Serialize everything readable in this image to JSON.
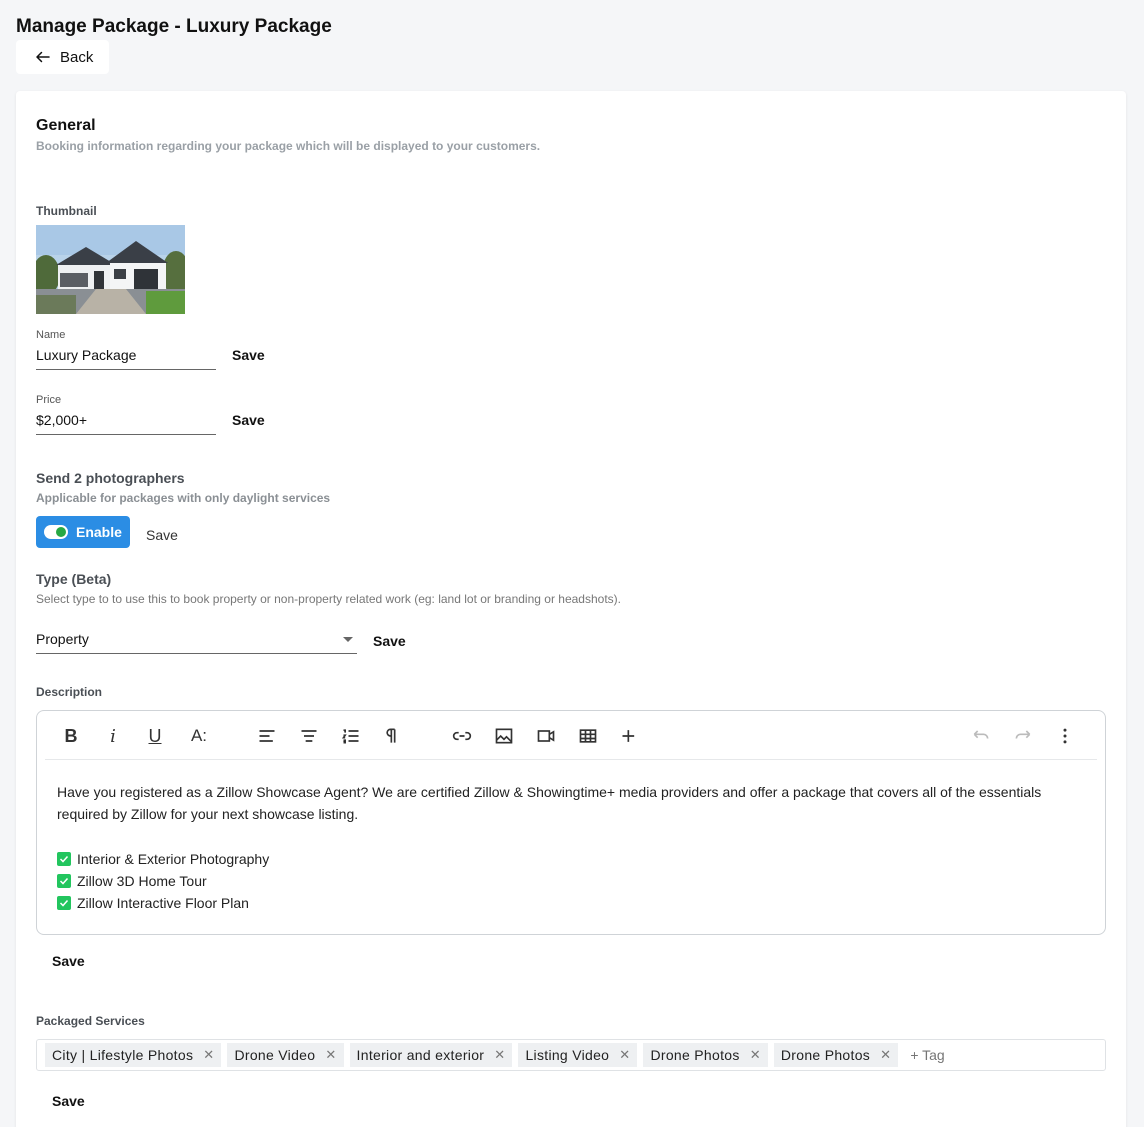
{
  "header": {
    "title": "Manage Package - Luxury Package",
    "back_label": "Back"
  },
  "general": {
    "title": "General",
    "subtitle": "Booking information regarding your package which will be displayed to your customers."
  },
  "thumbnail": {
    "label": "Thumbnail"
  },
  "name": {
    "label": "Name",
    "value": "Luxury Package",
    "save_label": "Save"
  },
  "price": {
    "label": "Price",
    "value": "$2,000+",
    "save_label": "Save"
  },
  "photographers": {
    "title": "Send 2 photographers",
    "subtitle": "Applicable for packages with only daylight services",
    "toggle_label": "Enable",
    "enabled": true,
    "save_label": "Save"
  },
  "type": {
    "title": "Type (Beta)",
    "subtitle": "Select type to to use this to book property or non-property related work (eg: land lot or branding or headshots).",
    "value": "Property",
    "save_label": "Save"
  },
  "description": {
    "label": "Description",
    "paragraph": "Have you registered as a Zillow Showcase Agent? We are certified Zillow & Showingtime+ media providers and offer a package that covers all of the essentials required by Zillow for your next showcase listing.",
    "checklist": [
      "Interior & Exterior Photography",
      "Zillow 3D Home Tour",
      "Zillow Interactive Floor Plan"
    ],
    "save_label": "Save",
    "toolbar": {
      "bold": "B",
      "italic": "i",
      "underline": "U",
      "font_size": "A:",
      "icons": [
        "bold-icon",
        "italic-icon",
        "underline-icon",
        "font-size-icon",
        "align-left-icon",
        "align-center-icon",
        "ordered-list-icon",
        "paragraph-format-icon",
        "link-icon",
        "image-icon",
        "video-icon",
        "table-icon",
        "insert-more-icon",
        "undo-icon",
        "redo-icon",
        "more-options-icon"
      ]
    }
  },
  "packaged_services": {
    "label": "Packaged Services",
    "tags": [
      "City | Lifestyle Photos",
      "Drone Video",
      "Interior and exterior",
      "Listing Video",
      "Drone Photos",
      "Drone Photos"
    ],
    "tag_placeholder": "+ Tag",
    "save_label": "Save"
  },
  "colors": {
    "accent": "#2b8de4",
    "check": "#22c55e",
    "toggle_knob": "#27a844"
  }
}
